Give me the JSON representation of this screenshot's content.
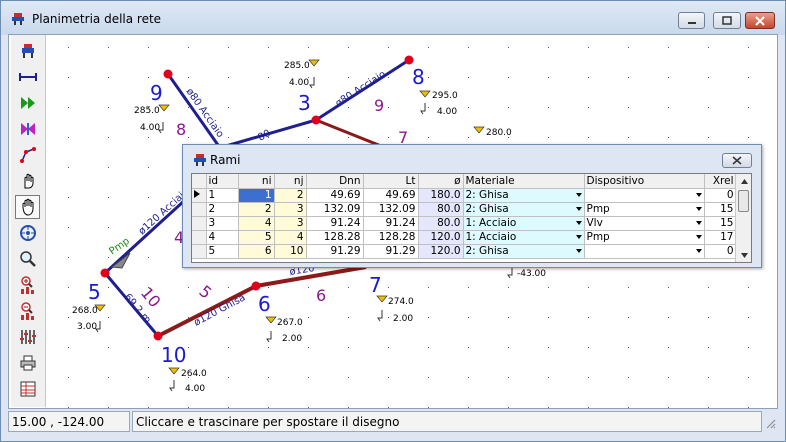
{
  "window": {
    "title": "Planimetria della rete"
  },
  "status": {
    "coords": "15.00 , -124.00",
    "hint": "Cliccare e trascinare per spostare il disegno"
  },
  "toolbar": [
    {
      "name": "toolbar-network-icon"
    },
    {
      "name": "toolbar-pipe-icon"
    },
    {
      "name": "toolbar-pump-icon"
    },
    {
      "name": "toolbar-valve-icon"
    },
    {
      "name": "toolbar-polyline-icon"
    },
    {
      "name": "toolbar-hand-icon"
    },
    {
      "name": "toolbar-pan-hand-icon",
      "pressed": true
    },
    {
      "name": "toolbar-target-icon"
    },
    {
      "name": "toolbar-zoom-icon"
    },
    {
      "name": "toolbar-zoom-in-icon"
    },
    {
      "name": "toolbar-zoom-out-icon"
    },
    {
      "name": "toolbar-equalizer-icon"
    },
    {
      "name": "toolbar-print-icon"
    },
    {
      "name": "toolbar-table-icon"
    }
  ],
  "network": {
    "nodes": [
      {
        "id": "9",
        "elev": "285.0",
        "head": "4.00"
      },
      {
        "id": "3",
        "elev": "285.0",
        "head": "4.00"
      },
      {
        "id": "8",
        "elev": "295.0",
        "head": "4.00"
      },
      {
        "id": "5",
        "elev": "268.0",
        "head": "3.00"
      },
      {
        "id": "10",
        "elev": "264.0",
        "head": "4.00"
      },
      {
        "id": "6",
        "elev": "267.0",
        "head": "2.00"
      },
      {
        "id": "7",
        "elev": "274.0",
        "head": "2.00"
      },
      {
        "id": "n280",
        "elev": "280.0"
      },
      {
        "id": "n43",
        "head": "-43.00"
      }
    ],
    "pipe_labels": [
      {
        "text": "ø80  Acciaio"
      },
      {
        "text": "ø80  Acciaio"
      },
      {
        "text": "ø120  Acciaio"
      },
      {
        "text": "ø120  Ghisa"
      },
      {
        "text": "69.2 m"
      },
      {
        "text": "ø120"
      },
      {
        "text": "80"
      },
      {
        "text": "Pmp"
      }
    ],
    "pipe_numbers": [
      "8",
      "9",
      "7",
      "4",
      "10",
      "5",
      "6"
    ]
  },
  "dialog": {
    "title": "Rami",
    "columns": [
      "id",
      "ni",
      "nj",
      "Dnn",
      "Lt",
      "ø",
      "Materiale",
      "Dispositivo",
      "Xrel"
    ],
    "rows": [
      {
        "id": "1",
        "ni": "1",
        "nj": "2",
        "dnn": "49.69",
        "lt": "49.69",
        "d": "180.0",
        "mat": "2: Ghisa",
        "disp": "",
        "xrel": "0"
      },
      {
        "id": "2",
        "ni": "2",
        "nj": "3",
        "dnn": "132.09",
        "lt": "132.09",
        "d": "80.0",
        "mat": "2: Ghisa",
        "disp": "Pmp",
        "xrel": "15"
      },
      {
        "id": "3",
        "ni": "4",
        "nj": "3",
        "dnn": "91.24",
        "lt": "91.24",
        "d": "80.0",
        "mat": "1: Acciaio",
        "disp": "Vlv",
        "xrel": "15"
      },
      {
        "id": "4",
        "ni": "5",
        "nj": "4",
        "dnn": "128.28",
        "lt": "128.28",
        "d": "120.0",
        "mat": "1: Acciaio",
        "disp": "Pmp",
        "xrel": "17"
      },
      {
        "id": "5",
        "ni": "6",
        "nj": "10",
        "dnn": "91.29",
        "lt": "91.29",
        "d": "120.0",
        "mat": "2: Ghisa",
        "disp": "",
        "xrel": "0"
      }
    ]
  },
  "colors": {
    "pipe_blue": "#1f1f8f",
    "pipe_red": "#8b1a1a",
    "node_red": "#e0001b",
    "label_blue": "#1a1ad0",
    "label_purple": "#8a1a8a",
    "label_green": "#1a8a1a"
  }
}
